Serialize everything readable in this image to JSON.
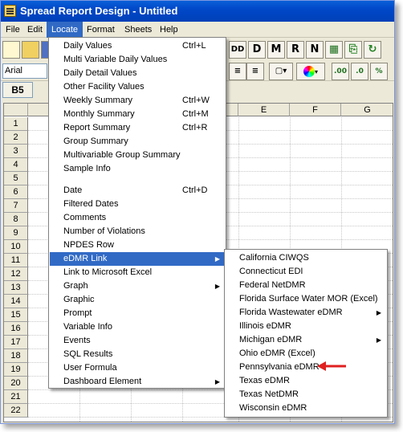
{
  "window": {
    "title": "Spread Report Design - Untitled"
  },
  "menubar": [
    "File",
    "Edit",
    "Locate",
    "Format",
    "Sheets",
    "Help"
  ],
  "toolbar": {
    "buttons": [
      "DD",
      "D",
      "M",
      "R",
      "N"
    ]
  },
  "format_bar": {
    "font_name": "Arial"
  },
  "cell_reference": "B5",
  "columns": [
    "E",
    "F",
    "G"
  ],
  "rows": [
    "1",
    "2",
    "3",
    "4",
    "5",
    "6",
    "7",
    "8",
    "9",
    "10",
    "11",
    "12",
    "13",
    "14",
    "15",
    "16",
    "17",
    "18",
    "19",
    "20",
    "21",
    "22"
  ],
  "locate_menu": {
    "group1": [
      {
        "label": "Daily Values",
        "shortcut": "Ctrl+L"
      },
      {
        "label": "Multi Variable Daily Values",
        "shortcut": ""
      },
      {
        "label": "Daily Detail Values",
        "shortcut": ""
      },
      {
        "label": "Other Facility Values",
        "shortcut": ""
      },
      {
        "label": "Weekly Summary",
        "shortcut": "Ctrl+W"
      },
      {
        "label": "Monthly Summary",
        "shortcut": "Ctrl+M"
      },
      {
        "label": "Report Summary",
        "shortcut": "Ctrl+R"
      },
      {
        "label": "Group Summary",
        "shortcut": ""
      },
      {
        "label": "Multivariable Group Summary",
        "shortcut": ""
      },
      {
        "label": "Sample Info",
        "shortcut": ""
      }
    ],
    "group2": [
      {
        "label": "Date",
        "shortcut": "Ctrl+D"
      },
      {
        "label": "Filtered Dates",
        "shortcut": ""
      },
      {
        "label": "Comments",
        "shortcut": ""
      },
      {
        "label": "Number of Violations",
        "shortcut": ""
      },
      {
        "label": "NPDES Row",
        "shortcut": ""
      },
      {
        "label": "eDMR Link",
        "shortcut": ""
      },
      {
        "label": "Link to Microsoft Excel",
        "shortcut": ""
      },
      {
        "label": "Graph",
        "shortcut": ""
      },
      {
        "label": "Graphic",
        "shortcut": ""
      },
      {
        "label": "Prompt",
        "shortcut": ""
      },
      {
        "label": "Variable Info",
        "shortcut": ""
      },
      {
        "label": "Events",
        "shortcut": ""
      },
      {
        "label": "SQL Results",
        "shortcut": ""
      },
      {
        "label": "User Formula",
        "shortcut": ""
      },
      {
        "label": "Dashboard Element",
        "shortcut": ""
      }
    ]
  },
  "edmr_submenu": [
    "California CIWQS",
    "Connecticut EDI",
    "Federal NetDMR",
    "Florida Surface Water MOR (Excel)",
    "Florida Wastewater eDMR",
    "Illinois eDMR",
    "Michigan eDMR",
    "Ohio eDMR (Excel)",
    "Pennsylvania eDMR",
    "Texas eDMR",
    "Texas NetDMR",
    "Wisconsin eDMR"
  ],
  "colors": {
    "title_bar": "#0a5fd8",
    "menu_highlight": "#316ac5",
    "pointer_arrow": "#e02020"
  }
}
